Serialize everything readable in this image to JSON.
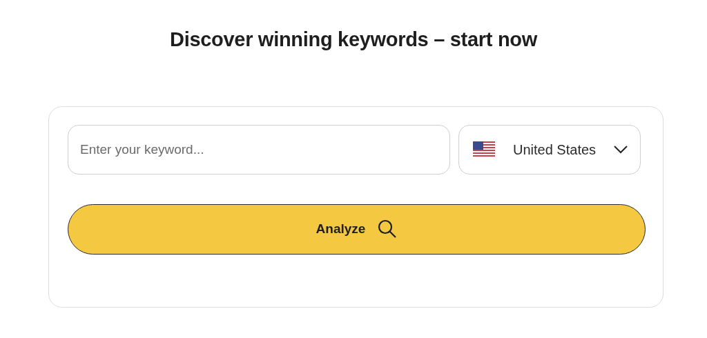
{
  "heading": "Discover winning keywords – start now",
  "keyword_field": {
    "placeholder": "Enter your keyword..."
  },
  "country_select": {
    "value": "United States"
  },
  "analyze_button": {
    "label": "Analyze"
  }
}
